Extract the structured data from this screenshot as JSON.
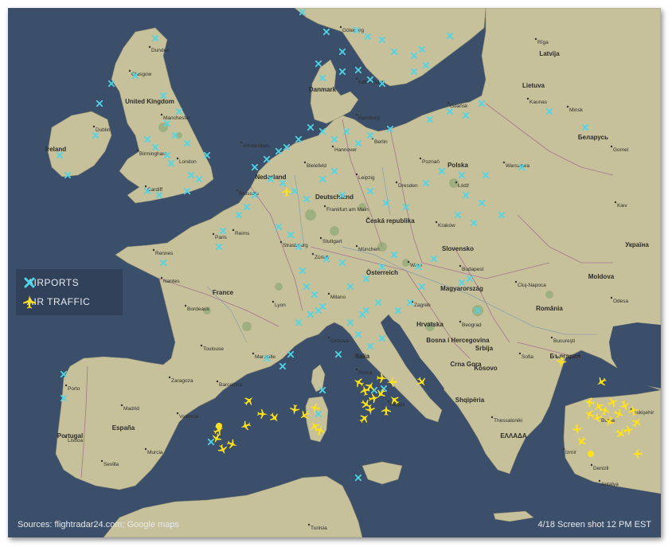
{
  "legend": {
    "airports_label": "AIRPORTS",
    "air_traffic_label": "AIR TRAFFIC"
  },
  "footer": {
    "sources": "Sources: flightradar24.com; Google maps",
    "timestamp": "4/18 Screen shot 12 PM EST"
  },
  "colors": {
    "sea": "#3b4f6a",
    "land": "#c9c3a0",
    "airport_marker": "#4fd6e6",
    "air_traffic_marker": "#ffe21a",
    "text": "#e8ecf0"
  },
  "country_labels": [
    "Latvija",
    "Lietuva",
    "Беларусь",
    "Ireland",
    "United Kingdom",
    "Danmark",
    "Nederland",
    "Deutschland",
    "Polska",
    "Česká republika",
    "Slovensko",
    "Österreich",
    "Magyarország",
    "România",
    "Moldova",
    "Україна",
    "France",
    "Italia",
    "Hrvatska",
    "Bosna i Hercegovina",
    "Srbija",
    "Crna Gora",
    "Kosovo",
    "България",
    "Shqipëria",
    "ΕΛΛΑΔΑ",
    "España",
    "Portugal"
  ],
  "city_labels": [
    "Rīga",
    "Kaunas",
    "Minsk",
    "Gomel",
    "Kiev",
    "Warszawa",
    "Gdańsk",
    "Poznań",
    "Łódź",
    "Kraków",
    "Berlin",
    "Hamburg",
    "Hannover",
    "Bielefeld",
    "Leipzig",
    "Dresden",
    "Frankfurt am Main",
    "München",
    "Stuttgart",
    "Wien",
    "Budapest",
    "Zagreb",
    "Beograd",
    "Bucureşti",
    "Cluj-Napoca",
    "Sofia",
    "Odesa",
    "Amsterdam",
    "Brussels",
    "Paris",
    "Reims",
    "Rennes",
    "Nantes",
    "Lyon",
    "Bordeaux",
    "Toulouse",
    "Marseille",
    "Strasbourg",
    "Zürich",
    "Genova",
    "Milano",
    "Roma",
    "Napoli",
    "Barcelona",
    "Madrid",
    "Valencia",
    "Zaragoza",
    "Sevilla",
    "Lisboa",
    "Porto",
    "Murcia",
    "Birmingham",
    "London",
    "Glasgow",
    "Dublin",
    "Manchester",
    "Cardiff",
    "København",
    "Göteborg",
    "Dundee",
    "Thessaloniki",
    "Eskişehir",
    "Antalya",
    "Denizli",
    "Bursa",
    "İzmir",
    "Tunisia"
  ]
}
